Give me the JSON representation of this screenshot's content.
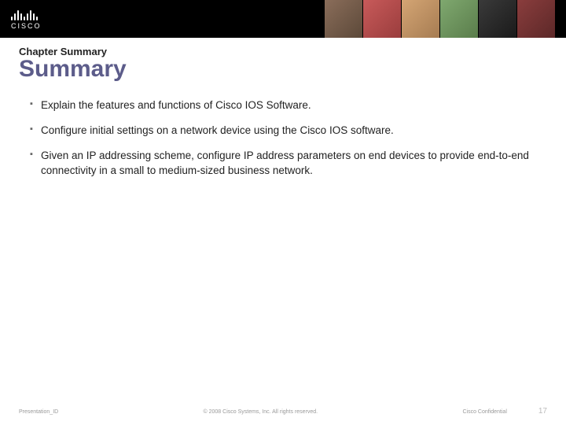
{
  "logo": {
    "brand": "CISCO"
  },
  "kicker": "Chapter Summary",
  "title": "Summary",
  "bullets": [
    "Explain the features and functions of Cisco IOS Software.",
    "Configure initial settings on a network device using the Cisco IOS software.",
    "Given an IP addressing scheme, configure IP address parameters on end devices to provide end-to-end connectivity in a small to medium-sized business network."
  ],
  "footer": {
    "left": "Presentation_ID",
    "center": "© 2008 Cisco Systems, Inc. All rights reserved.",
    "confidential": "Cisco Confidential",
    "page": "17"
  }
}
